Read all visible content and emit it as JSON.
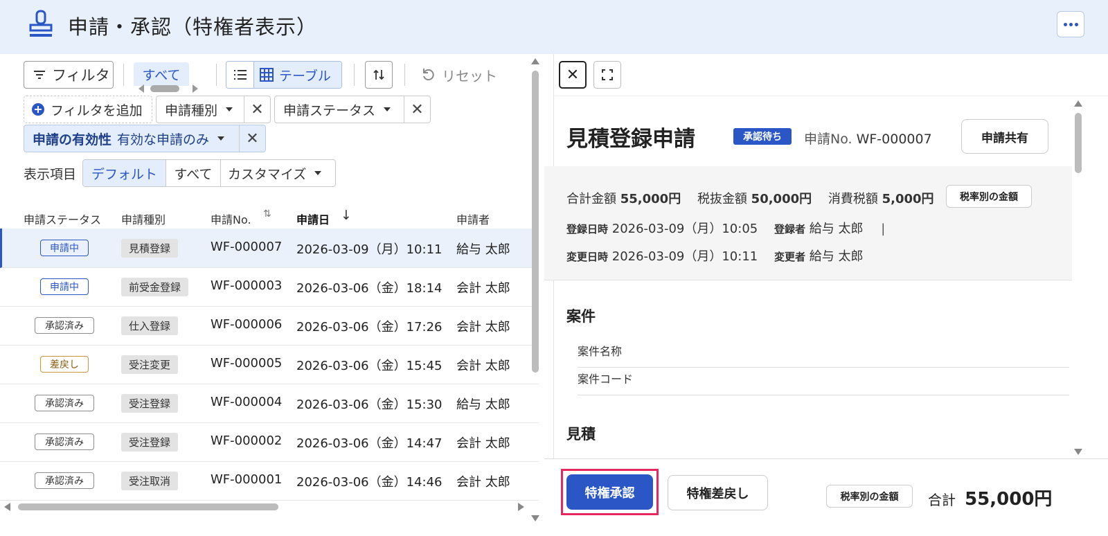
{
  "app": {
    "title": "申請・承認（特権者表示）",
    "icon": "stamp-icon"
  },
  "toolbar": {
    "filter_label": "フィルタ",
    "view_tab": "すべて",
    "view_table": "テーブル",
    "reset_label": "リセット"
  },
  "filters": {
    "add_label": "フィルタを追加",
    "chips": [
      "申請種別",
      "申請ステータス"
    ],
    "validity_label": "申請の有効性",
    "validity_value": "有効な申請のみ"
  },
  "display": {
    "label": "表示項目",
    "options": [
      "デフォルト",
      "すべて",
      "カスタマイズ"
    ]
  },
  "table": {
    "headers": [
      "申請ステータス",
      "申請種別",
      "申請No.",
      "申請日",
      "申請者"
    ],
    "rows": [
      {
        "status": "申請中",
        "status_kind": "pending",
        "type": "見積登録",
        "no": "WF-000007",
        "date": "2026-03-09（月）10:11",
        "applicant": "給与 太郎",
        "selected": true
      },
      {
        "status": "申請中",
        "status_kind": "pending",
        "type": "前受金登録",
        "no": "WF-000003",
        "date": "2026-03-06（金）18:14",
        "applicant": "会計 太郎"
      },
      {
        "status": "承認済み",
        "status_kind": "approved",
        "type": "仕入登録",
        "no": "WF-000006",
        "date": "2026-03-06（金）17:26",
        "applicant": "会計 太郎"
      },
      {
        "status": "差戻し",
        "status_kind": "returned",
        "type": "受注変更",
        "no": "WF-000005",
        "date": "2026-03-06（金）15:45",
        "applicant": "会計 太郎"
      },
      {
        "status": "承認済み",
        "status_kind": "approved",
        "type": "受注登録",
        "no": "WF-000004",
        "date": "2026-03-06（金）15:30",
        "applicant": "給与 太郎"
      },
      {
        "status": "承認済み",
        "status_kind": "approved",
        "type": "受注登録",
        "no": "WF-000002",
        "date": "2026-03-06（金）14:47",
        "applicant": "会計 太郎"
      },
      {
        "status": "承認済み",
        "status_kind": "approved",
        "type": "受注取消",
        "no": "WF-000001",
        "date": "2026-03-06（金）14:46",
        "applicant": "会計 太郎"
      }
    ]
  },
  "detail": {
    "title": "見積登録申請",
    "badge": "承認待ち",
    "no_label": "申請No.",
    "no_value": "WF-000007",
    "share_label": "申請共有",
    "total_label": "合計金額",
    "total_value": "55,000円",
    "pretax_label": "税抜金額",
    "pretax_value": "50,000円",
    "tax_label": "消費税額",
    "tax_value": "5,000円",
    "by_rate_label": "税率別の金額",
    "created_label": "登録日時",
    "created_value": "2026-03-09（月）10:05",
    "creator_label": "登録者",
    "creator_value": "給与 太郎",
    "separator": "|",
    "modified_label": "変更日時",
    "modified_value": "2026-03-09（月）10:11",
    "modifier_label": "変更者",
    "modifier_value": "給与 太郎",
    "section_project": "案件",
    "project_name_label": "案件名称",
    "project_code_label": "案件コード",
    "section_estimate": "見積"
  },
  "footer": {
    "approve_label": "特権承認",
    "return_label": "特権差戻し",
    "by_rate_label": "税率別の金額",
    "total_label": "合計",
    "total_value": "55,000円"
  },
  "colors": {
    "accent": "#2a56c6",
    "header_bg": "#e8f0fb",
    "highlight": "#e8275e"
  }
}
